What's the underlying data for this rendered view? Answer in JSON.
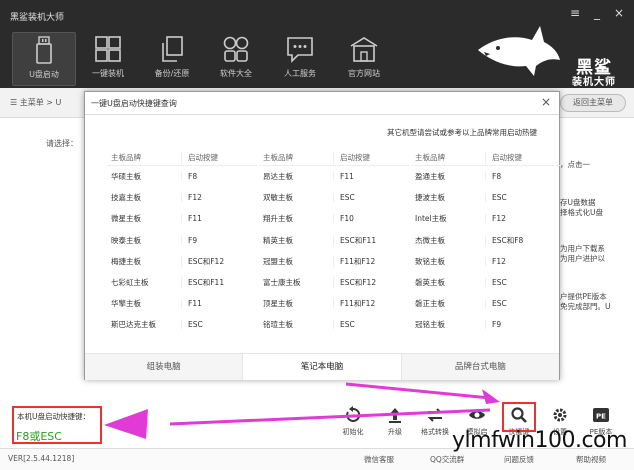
{
  "app": {
    "title": "黑鲨装机大师"
  },
  "window_controls": [
    "≡",
    "_",
    "×"
  ],
  "nav": [
    {
      "label": "U盘启动",
      "icon": "usb-drive-icon",
      "active": true
    },
    {
      "label": "一键装机",
      "icon": "windows-icon"
    },
    {
      "label": "备份/还原",
      "icon": "backup-icon"
    },
    {
      "label": "软件大全",
      "icon": "apps-grid-icon"
    },
    {
      "label": "人工服务",
      "icon": "chat-icon"
    },
    {
      "label": "官方网站",
      "icon": "website-icon"
    }
  ],
  "logo": {
    "text_line1": "黑鲨",
    "text_line2": "装机大师"
  },
  "subbar": {
    "crumb": "☰ 主菜单 > U",
    "back": "返回主菜单"
  },
  "main": {
    "choose_label": "请选择：",
    "right_snippets": [
      "，点击一",
      "存U盘数据",
      "择格式化U盘",
      "为用户下载系",
      "为用户进护以",
      "户提供PE版本",
      "免完成部門。U"
    ]
  },
  "modal": {
    "title": "一键U盘启动快捷键查询",
    "close": "×",
    "tip": "其它机型请尝试或参考以上品牌常用启动热键",
    "headers": {
      "brand": "主板品牌",
      "key": "启动按键"
    },
    "columns": [
      [
        [
          "华硕主板",
          "F8"
        ],
        [
          "技嘉主板",
          "F12"
        ],
        [
          "微星主板",
          "F11"
        ],
        [
          "映泰主板",
          "F9"
        ],
        [
          "梅捷主板",
          "ESC和F12"
        ],
        [
          "七彩虹主板",
          "ESC和F11"
        ],
        [
          "华擎主板",
          "F11"
        ],
        [
          "斯巴达克主板",
          "ESC"
        ]
      ],
      [
        [
          "昂达主板",
          "F11"
        ],
        [
          "双敏主板",
          "ESC"
        ],
        [
          "翔升主板",
          "F10"
        ],
        [
          "精英主板",
          "ESC和F11"
        ],
        [
          "冠盟主板",
          "F11和F12"
        ],
        [
          "富士康主板",
          "ESC和F12"
        ],
        [
          "顶星主板",
          "F11和F12"
        ],
        [
          "铭瑄主板",
          "ESC"
        ]
      ],
      [
        [
          "盈通主板",
          "F8"
        ],
        [
          "捷波主板",
          "ESC"
        ],
        [
          "Intel主板",
          "F12"
        ],
        [
          "杰微主板",
          "ESC和F8"
        ],
        [
          "致铭主板",
          "F12"
        ],
        [
          "磐英主板",
          "ESC"
        ],
        [
          "磐正主板",
          "ESC"
        ],
        [
          "冠铭主板",
          "F9"
        ]
      ]
    ],
    "tabs": [
      "组装电脑",
      "笔记本电脑",
      "品牌台式电脑"
    ],
    "active_tab": 1
  },
  "hotkey": {
    "label": "本机U盘启动快捷键：",
    "value": "F8或ESC"
  },
  "tools": [
    {
      "label": "初始化",
      "icon": "reset-icon"
    },
    {
      "label": "升级",
      "icon": "upgrade-icon"
    },
    {
      "label": "格式转换",
      "icon": "convert-icon"
    },
    {
      "label": "模拟启",
      "icon": "preview-eye-icon"
    },
    {
      "label": "快捷键",
      "icon": "search-icon"
    },
    {
      "label": "设置",
      "icon": "gear-icon"
    },
    {
      "label": "PE版本",
      "icon": "pe-icon"
    }
  ],
  "status": {
    "version": "VER[2.5.44.1218]",
    "links": [
      "微信客服",
      "QQ交流群",
      "问题反馈",
      "帮助视频"
    ]
  },
  "watermark": "ylmfwin100.com",
  "colors": {
    "topbar": "#2b2b2b",
    "highlight": "#e8332e",
    "arrow": "#e23ad6",
    "hotkey_value": "#2a9d1f"
  }
}
